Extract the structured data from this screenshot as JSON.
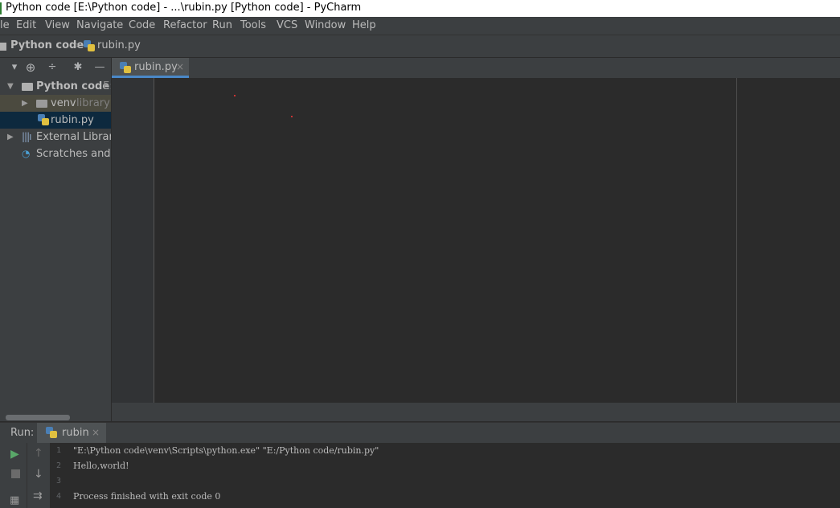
{
  "window": {
    "title": "Python code [E:\\Python code] - ...\\rubin.py [Python code] - PyCharm"
  },
  "menu": {
    "items": [
      "le",
      "Edit",
      "View",
      "Navigate",
      "Code",
      "Refactor",
      "Run",
      "Tools",
      "VCS",
      "Window",
      "Help"
    ]
  },
  "nav": {
    "project": "Python code",
    "file": "rubin.py"
  },
  "project_tree": {
    "root_label": "Python code",
    "root_path": "E:",
    "venv_label": "venv",
    "venv_hint": "library r",
    "file_label": "rubin.py",
    "external_label": "External Librarie",
    "scratches_label": "Scratches and C"
  },
  "editor": {
    "tab_label": "rubin.py"
  },
  "run": {
    "label": "Run:",
    "tab_label": "rubin",
    "lines": [
      {
        "n": "1",
        "text": "\"E:\\Python code\\venv\\Scripts\\python.exe\" \"E:/Python code/rubin.py\""
      },
      {
        "n": "2",
        "text": "Hello,world!"
      },
      {
        "n": "3",
        "text": ""
      },
      {
        "n": "4",
        "text": "Process finished with exit code 0"
      }
    ]
  },
  "colors": {
    "accent": "#4a88c7",
    "run_green": "#59a869",
    "background": "#2b2b2b",
    "panel": "#3c3f41"
  }
}
